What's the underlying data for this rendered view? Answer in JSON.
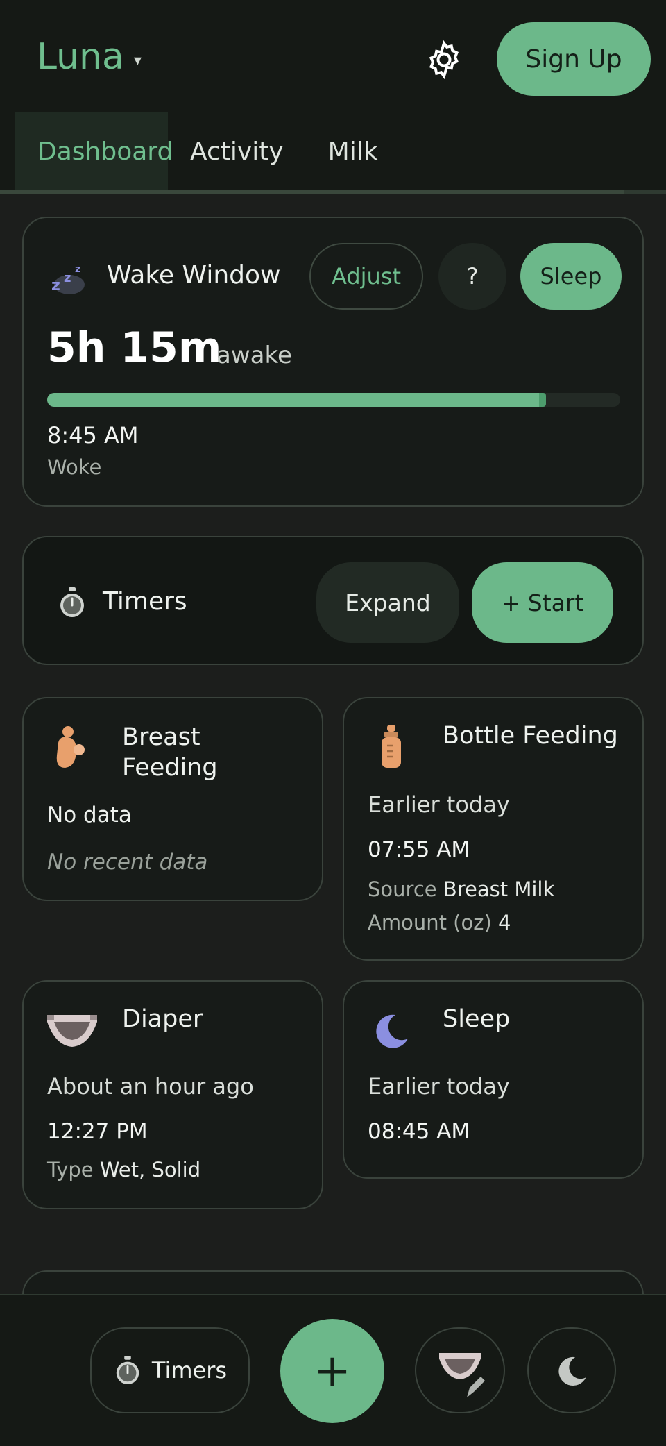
{
  "header": {
    "app_name": "Luna",
    "chevron": "▾",
    "settings_icon": "gear-icon",
    "signup_label": "Sign Up"
  },
  "tabs": [
    {
      "label": "Dashboard",
      "active": true
    },
    {
      "label": "Activity",
      "active": false
    },
    {
      "label": "Milk",
      "active": false
    }
  ],
  "wake_window": {
    "icon": "zzz-icon",
    "title": "Wake Window",
    "adjust_label": "Adjust",
    "help_label": "?",
    "sleep_label": "Sleep",
    "elapsed": "5h 15m",
    "elapsed_suffix": "awake",
    "progress": 0.87,
    "woke_time": "8:45 AM",
    "woke_label": "Woke"
  },
  "timers": {
    "title": "Timers",
    "expand_label": "Expand",
    "start_label": "+  Start"
  },
  "cards": {
    "breast": {
      "title": "Breast Feeding",
      "status": "No data",
      "note": "No recent data"
    },
    "bottle": {
      "title": "Bottle Feeding",
      "when": "Earlier today",
      "time": "07:55 AM",
      "source_label": "Source",
      "source_value": "Breast Milk",
      "amount_label": "Amount (oz)",
      "amount_value": "4"
    },
    "diaper": {
      "title": "Diaper",
      "when": "About an hour ago",
      "time": "12:27 PM",
      "type_label": "Type",
      "type_value": "Wet, Solid"
    },
    "sleep": {
      "title": "Sleep",
      "when": "Earlier today",
      "time": "08:45 AM"
    }
  },
  "bottom_nav": {
    "timers_label": "Timers",
    "add_label": "+",
    "diaper_edit_icon": "diaper-edit-icon",
    "sleep_icon": "moon-icon"
  },
  "colors": {
    "accent": "#6cb88a",
    "background": "#1c1e1c",
    "card": "#171b18"
  }
}
